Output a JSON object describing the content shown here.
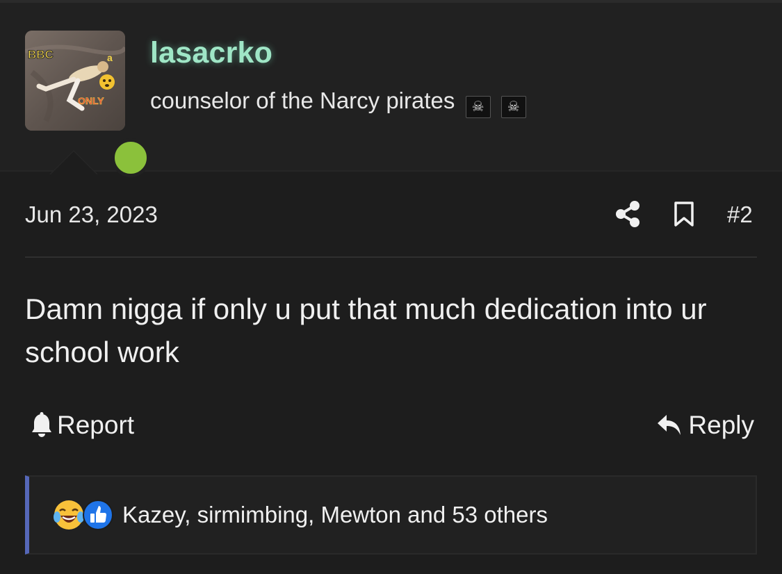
{
  "user": {
    "username": "lasacrko",
    "title": "counselor of the Narcy pirates",
    "title_flags": [
      "☠",
      "☠"
    ],
    "avatar_text_top": "BBC",
    "avatar_text_bottom": "ONLY",
    "avatar_text_side": "a",
    "online_color": "#8bc13b",
    "username_color": "#9fe6c6"
  },
  "post": {
    "date": "Jun 23, 2023",
    "number": "#2",
    "message": "Damn nigga if only u put that much dedication into ur school work",
    "icons": {
      "share": "share-icon",
      "bookmark": "bookmark-icon"
    }
  },
  "actions": {
    "report_label": "Report",
    "reply_label": "Reply",
    "report_icon": "bell-icon",
    "reply_icon": "reply-arrow-icon"
  },
  "reactions": {
    "icons": [
      "laughing-crying-emoji-icon",
      "thumbs-up-icon"
    ],
    "summary": "Kazey, sirmimbing, Mewton and 53 others",
    "accent_color": "#5567b8"
  }
}
